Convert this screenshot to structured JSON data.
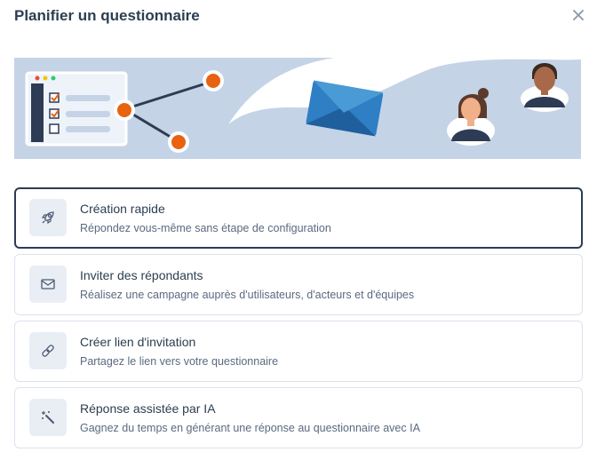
{
  "modal": {
    "title": "Planifier un questionnaire",
    "close_icon": "close-icon"
  },
  "colors": {
    "accent": "#e8620f",
    "banner_bg": "#c5d3e6",
    "selected_border": "#2d3b55",
    "icon_bg": "#e9eef5"
  },
  "options": [
    {
      "title": "Création rapide",
      "description": "Répondez vous-même sans étape de configuration",
      "icon": "rocket-icon",
      "selected": true
    },
    {
      "title": "Inviter des répondants",
      "description": "Réalisez une campagne auprès d'utilisateurs, d'acteurs et d'équipes",
      "icon": "envelope-icon",
      "selected": false
    },
    {
      "title": "Créer lien d'invitation",
      "description": "Partagez le lien vers votre questionnaire",
      "icon": "link-icon",
      "selected": false
    },
    {
      "title": "Réponse assistée par IA",
      "description": "Gagnez du temps en générant une réponse au questionnaire avec IA",
      "icon": "magic-wand-icon",
      "selected": false
    }
  ]
}
